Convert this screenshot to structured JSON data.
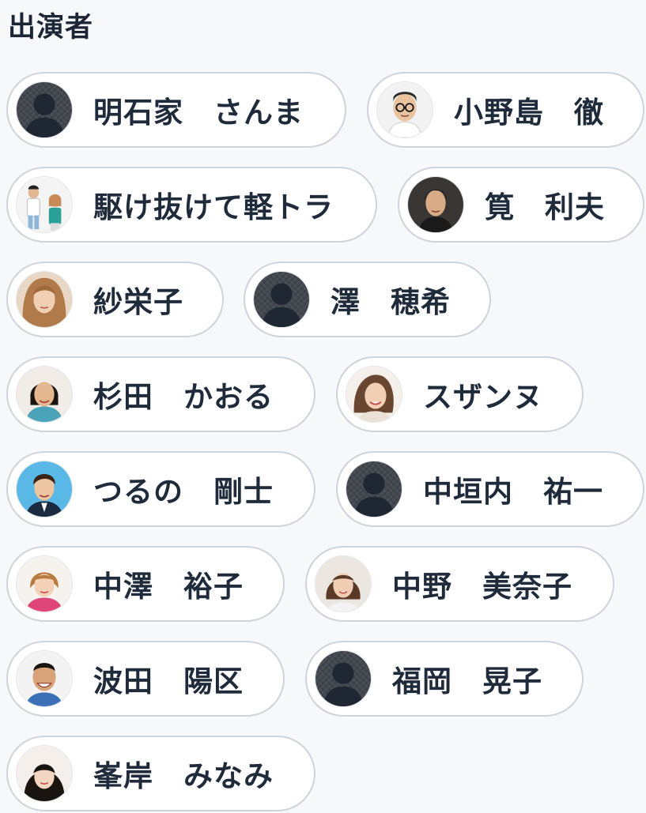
{
  "section": {
    "title": "出演者"
  },
  "cast": [
    {
      "name": "明石家　さんま",
      "photo": "placeholder-silhouette"
    },
    {
      "name": "小野島　徹",
      "photo": "portrait-glasses"
    },
    {
      "name": "駆け抜けて軽トラ",
      "photo": "portrait-duo"
    },
    {
      "name": "筧　利夫",
      "photo": "portrait-man"
    },
    {
      "name": "紗栄子",
      "photo": "portrait-woman-light"
    },
    {
      "name": "澤　穂希",
      "photo": "placeholder-silhouette"
    },
    {
      "name": "杉田　かおる",
      "photo": "portrait-woman-dark"
    },
    {
      "name": "スザンヌ",
      "photo": "portrait-woman-smile"
    },
    {
      "name": "つるの　剛士",
      "photo": "portrait-man-suit"
    },
    {
      "name": "中垣内　祐一",
      "photo": "placeholder-silhouette"
    },
    {
      "name": "中澤　裕子",
      "photo": "portrait-woman-short"
    },
    {
      "name": "中野　美奈子",
      "photo": "portrait-woman-bob"
    },
    {
      "name": "波田　陽区",
      "photo": "portrait-man-smile"
    },
    {
      "name": "福岡　晃子",
      "photo": "placeholder-silhouette"
    },
    {
      "name": "峯岸　みなみ",
      "photo": "portrait-woman-bangs"
    }
  ]
}
